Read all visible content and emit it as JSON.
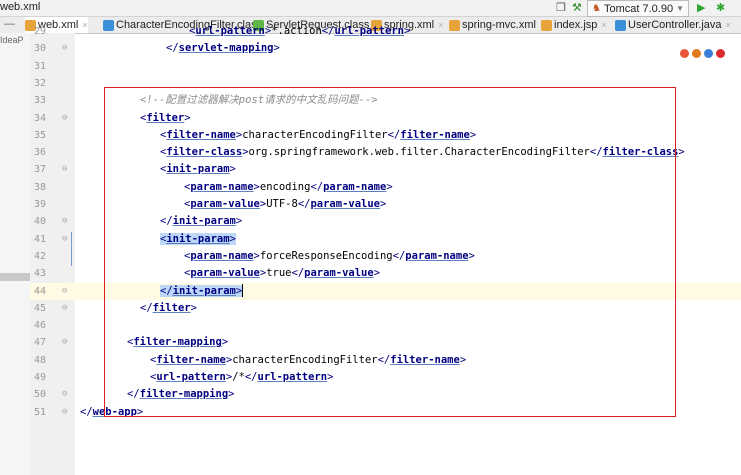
{
  "title": "web.xml",
  "run_config": {
    "label": "Tomcat 7.0.90"
  },
  "left_pane_label": "IdeaP",
  "tabs": [
    {
      "label": "web.xml",
      "icon": "xml-file-icon",
      "color": "#e8a33a",
      "active": true
    },
    {
      "label": "CharacterEncodingFilter.class",
      "icon": "class-file-icon",
      "color": "#3a8fd8",
      "active": false
    },
    {
      "label": "ServletRequest.class",
      "icon": "interface-file-icon",
      "color": "#5fb845",
      "active": false
    },
    {
      "label": "spring.xml",
      "icon": "xml-file-icon",
      "color": "#e8a33a",
      "active": false
    },
    {
      "label": "spring-mvc.xml",
      "icon": "xml-file-icon",
      "color": "#e8a33a",
      "active": false
    },
    {
      "label": "index.jsp",
      "icon": "jsp-file-icon",
      "color": "#e8a33a",
      "active": false
    },
    {
      "label": "UserController.java",
      "icon": "class-file-icon",
      "color": "#3a8fd8",
      "active": false
    }
  ],
  "lines": [
    {
      "n": "29",
      "t": "url-pattern",
      "v": "*.action"
    },
    {
      "n": "30",
      "t": "/servlet-mapping"
    },
    {
      "n": "31"
    },
    {
      "n": "32"
    },
    {
      "n": "33",
      "c": "<!--配置过滤器解决post请求的中文乱码问题-->"
    },
    {
      "n": "34",
      "t": "filter"
    },
    {
      "n": "35",
      "t": "filter-name",
      "v": "characterEncodingFilter"
    },
    {
      "n": "36",
      "t": "filter-class",
      "v": "org.springframework.web.filter.CharacterEncodingFilter"
    },
    {
      "n": "37",
      "t": "init-param"
    },
    {
      "n": "38",
      "t": "param-name",
      "v": "encoding"
    },
    {
      "n": "39",
      "t": "param-value",
      "v": "UTF-8"
    },
    {
      "n": "40",
      "t": "/init-param"
    },
    {
      "n": "41",
      "t": "init-param"
    },
    {
      "n": "42",
      "t": "param-name",
      "v": "forceResponseEncoding"
    },
    {
      "n": "43",
      "t": "param-value",
      "v": "true"
    },
    {
      "n": "44",
      "t": "/init-param"
    },
    {
      "n": "45",
      "t": "/filter"
    },
    {
      "n": "46"
    },
    {
      "n": "47",
      "t": "filter-mapping"
    },
    {
      "n": "48",
      "t": "filter-name",
      "v": "characterEncodingFilter"
    },
    {
      "n": "49",
      "t": "url-pattern",
      "v": "/*"
    },
    {
      "n": "50",
      "t": "/filter-mapping"
    },
    {
      "n": "51",
      "t": "/web-app"
    }
  ],
  "colors": {
    "tag": "#000080",
    "comment": "#8c8c8c",
    "highlight_box": "#e02020",
    "selection": "#bcd7f7",
    "current_line": "#fffae3"
  }
}
